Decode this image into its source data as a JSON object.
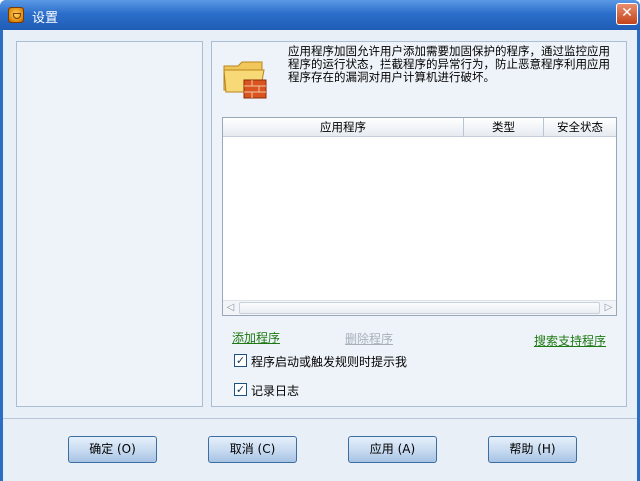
{
  "window": {
    "title": "设置",
    "close_symbol": "✕"
  },
  "description": "应用程序加固允许用户添加需要加固保护的程序，通过监控应用程序的运行状态，拦截程序的异常行为，防止恶意程序利用应用程序存在的漏洞对用户计算机进行破坏。",
  "table": {
    "columns": [
      "应用程序",
      "类型",
      "安全状态"
    ],
    "rows": []
  },
  "actions": {
    "add": "添加程序",
    "delete": "删除程序",
    "search": "搜索支持程序"
  },
  "options": [
    {
      "label": "程序启动或触发规则时提示我",
      "checked": true
    },
    {
      "label": "记录日志",
      "checked": true
    }
  ],
  "buttons": {
    "ok": "确定 (O)",
    "cancel": "取消 (C)",
    "apply": "应用 (A)",
    "help": "帮助 (H)"
  },
  "icons": {
    "app": "shield-app-icon",
    "hero": "folder-firewall-icon"
  },
  "colors": {
    "titlebar": "#2c6ecb",
    "link": "#1d7a12",
    "disabled_link": "#a8b0ba"
  }
}
